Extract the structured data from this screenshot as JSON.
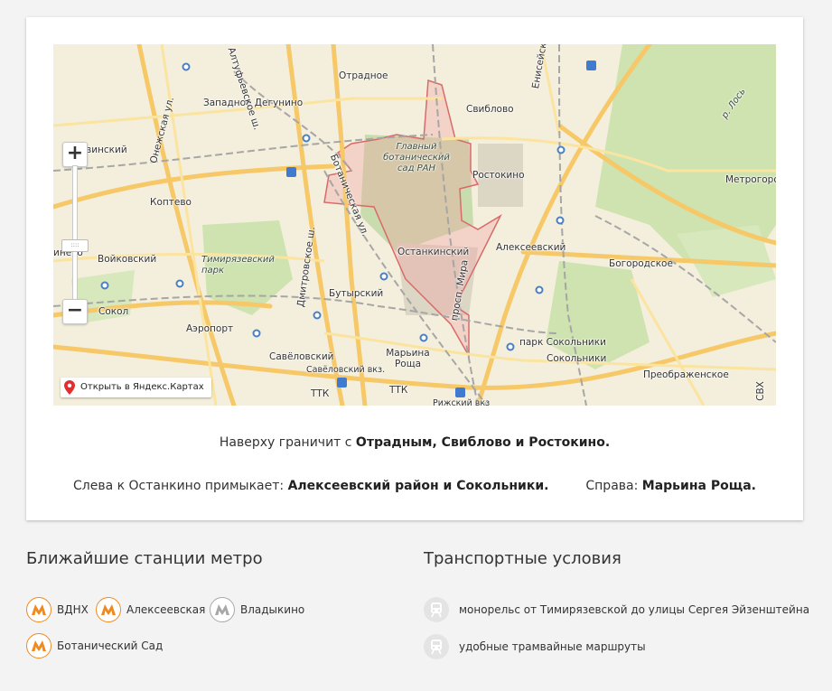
{
  "map": {
    "labels": {
      "otradnoe": "Отрадное",
      "zapadnoe_degunino": "Западное Дегунино",
      "sviblovo": "Свиблово",
      "bot_sad": "Главный ботанический сад РАН",
      "rostokino": "Ростокино",
      "metrogorodok": "Метрогородок",
      "koptevo": "Коптево",
      "vojkovskij": "Войковский",
      "timiryazevskij": "Тимирязевский парк",
      "ostankinskij": "Останкинский",
      "alekseevskij": "Алексеевский",
      "bogorodskoe": "Богородское",
      "butyrskij": "Бутырский",
      "sokol": "Сокол",
      "aeroport": "Аэропорт",
      "savelovskij": "Савёловский",
      "savelovskij_vkz": "Савёловский вкз.",
      "marina_roshcha": "Марьина Роща",
      "park_sokolniki": "парк Сокольники",
      "sokolniki": "Сокольники",
      "preobrazhenskoe": "Преображенское",
      "rizhskij_vkz": "Рижский вкз",
      "ttk1": "ТТК",
      "ttk2": "ТТК",
      "svh": "СВХ",
      "pr_mira": "просп. Мира",
      "dmitrovskoe": "Дмитровское ш.",
      "botanicheskaya": "Ботаническая ул.",
      "r_los": "р. Лось",
      "eniseyskaya": "Енисейская",
      "onezhskaya": "Онежская ул.",
      "altufevskoe": "Алтуфьевское ш.",
      "vinskij": "винский",
      "hineevo": "инево"
    },
    "zoom_in": "+",
    "zoom_out": "−",
    "zoom_handle": "::::",
    "open_link": "Открыть в Яндекс.Картах"
  },
  "description": {
    "top_prefix": "Наверху граничит с ",
    "top_bold": "Отрадным, Свиблово и Ростокино.",
    "left_prefix": "Слева к Останкино примыкает: ",
    "left_bold": "Алексеевский район и Сокольники.",
    "right_prefix": "Справа: ",
    "right_bold": "Марьина Роща."
  },
  "metro": {
    "title": "Ближайшие станции метро",
    "stations": [
      {
        "name": "ВДНХ",
        "color": "#f08a1f"
      },
      {
        "name": "Алексеевская",
        "color": "#f08a1f"
      },
      {
        "name": "Владыкино",
        "color": "#a8a8a8"
      },
      {
        "name": "Ботанический Сад",
        "color": "#f08a1f"
      }
    ]
  },
  "transport": {
    "title": "Транспортные условия",
    "items": [
      {
        "text": "монорельс от Тимирязевской до улицы Сергея Эйзенштейна"
      },
      {
        "text": "удобные трамвайные маршруты"
      }
    ]
  }
}
